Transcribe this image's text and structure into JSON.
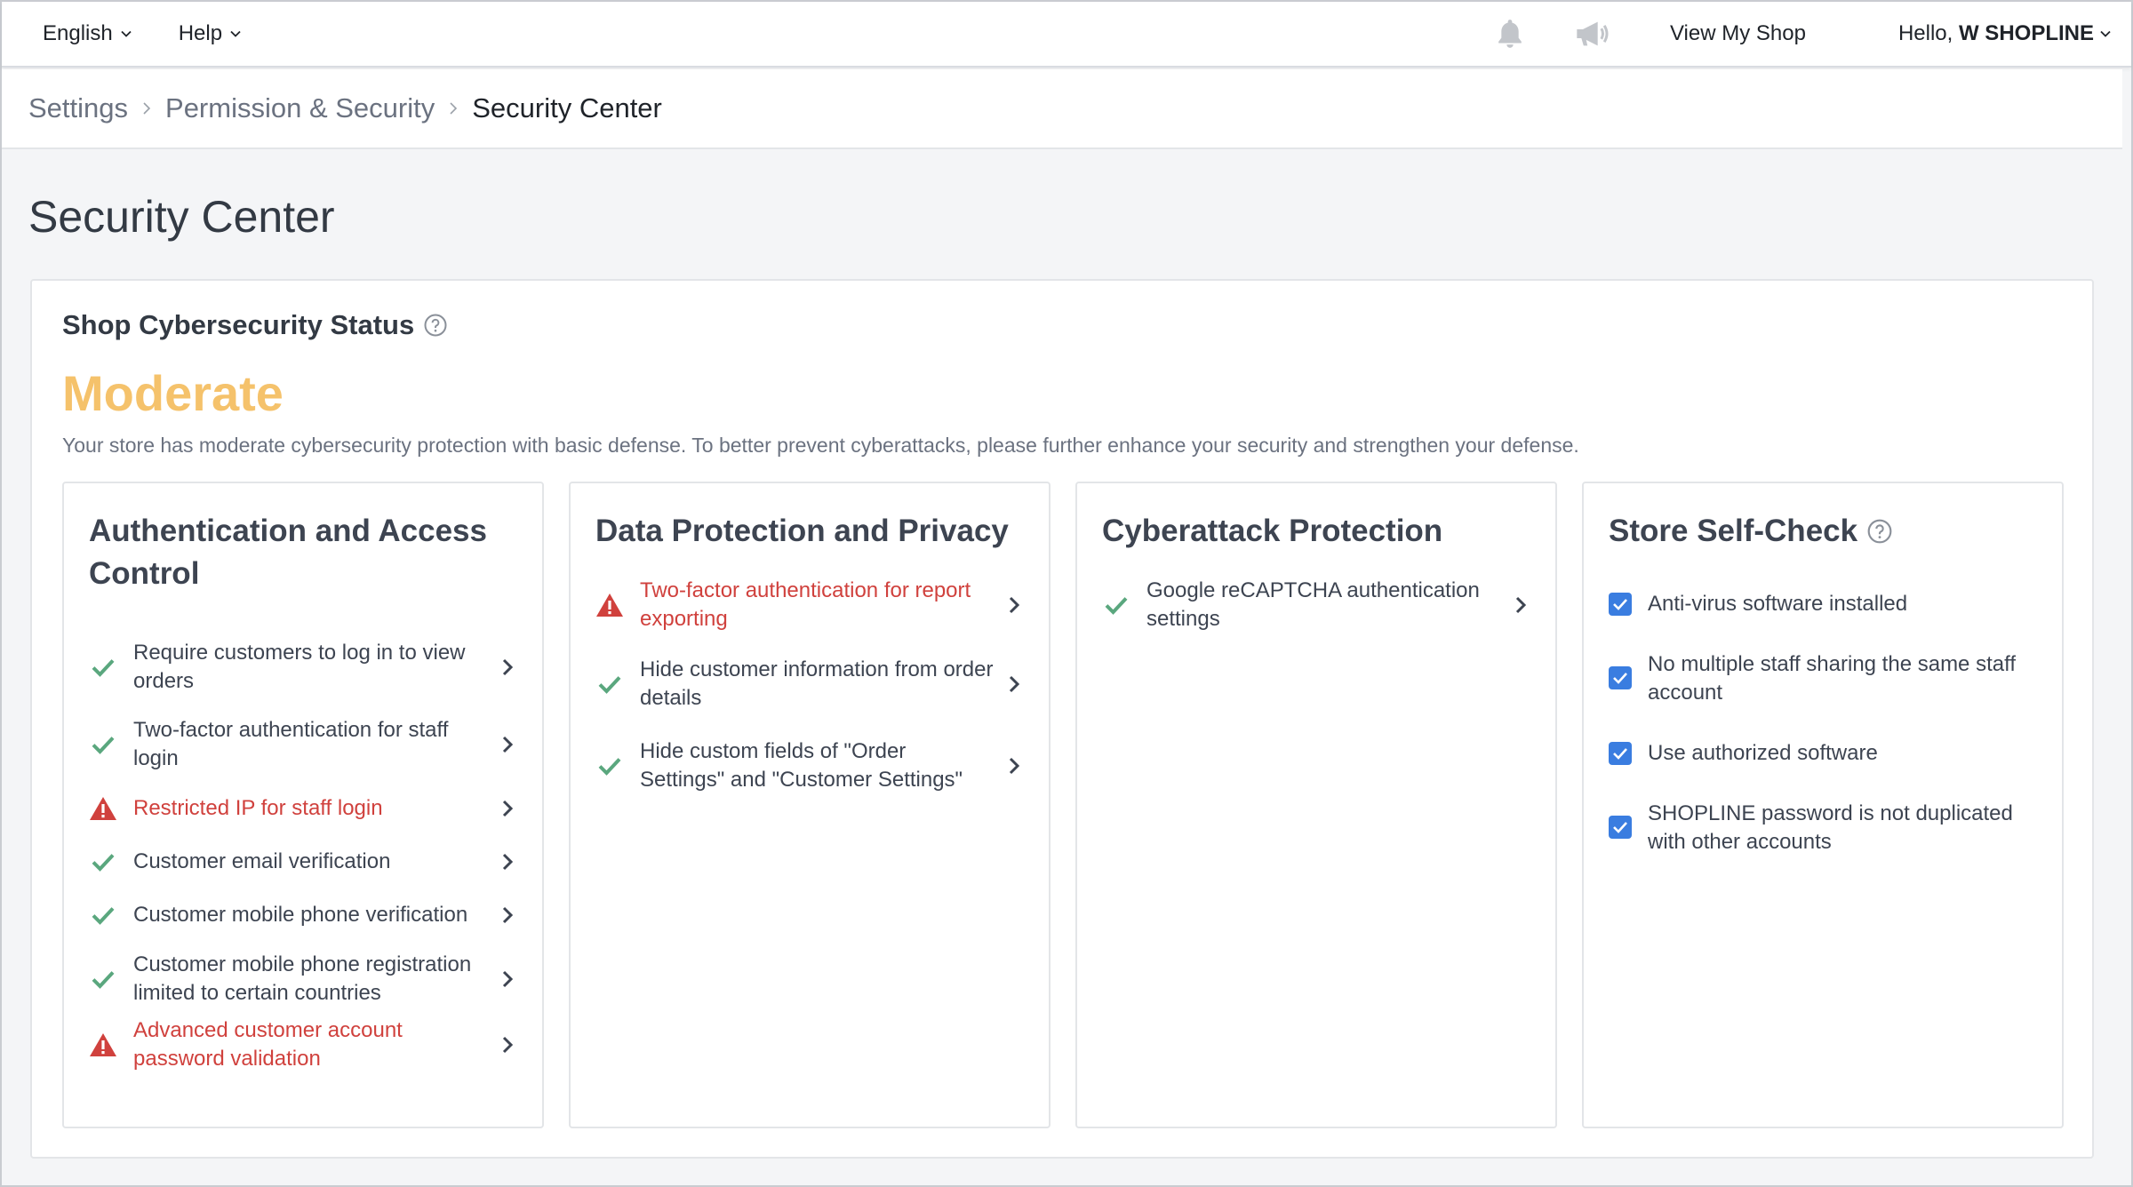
{
  "topbar": {
    "language": "English",
    "help": "Help",
    "view_shop": "View My Shop",
    "hello_prefix": "Hello, ",
    "user_name": "W SHOPLINE",
    "icons": [
      "bell-icon",
      "megaphone-icon"
    ]
  },
  "breadcrumb": {
    "items": [
      "Settings",
      "Permission & Security",
      "Security Center"
    ]
  },
  "page": {
    "title": "Security Center"
  },
  "status": {
    "heading": "Shop Cybersecurity Status",
    "level": "Moderate",
    "level_color": "#f5c26b",
    "description": "Your store has moderate cybersecurity protection with basic defense. To better prevent cyberattacks, please further enhance your security and strengthen your defense."
  },
  "colors": {
    "ok": "#5aa77e",
    "warn": "#d0413d",
    "checkbox": "#3a7de0"
  },
  "panels": [
    {
      "title": "Authentication and Access Control",
      "items": [
        {
          "label": "Require customers to log in to view orders",
          "status": "ok"
        },
        {
          "label": "Two-factor authentication for staff login",
          "status": "ok"
        },
        {
          "label": "Restricted IP for staff login",
          "status": "warn"
        },
        {
          "label": "Customer email verification",
          "status": "ok"
        },
        {
          "label": "Customer mobile phone verification",
          "status": "ok"
        },
        {
          "label": "Customer mobile phone registration limited to certain countries",
          "status": "ok"
        },
        {
          "label": "Advanced customer account password validation",
          "status": "warn"
        }
      ]
    },
    {
      "title": "Data Protection and Privacy",
      "items": [
        {
          "label": "Two-factor authentication for report exporting",
          "status": "warn"
        },
        {
          "label": "Hide customer information from order details",
          "status": "ok"
        },
        {
          "label": "Hide custom fields of \"Order Settings\" and \"Customer Settings\"",
          "status": "ok"
        }
      ]
    },
    {
      "title": "Cyberattack Protection",
      "items": [
        {
          "label": "Google reCAPTCHA authentication settings",
          "status": "ok"
        }
      ]
    },
    {
      "title": "Store Self-Check",
      "checks": [
        {
          "label": "Anti-virus software installed",
          "checked": true
        },
        {
          "label": "No multiple staff sharing the same staff account",
          "checked": true
        },
        {
          "label": "Use authorized software",
          "checked": true
        },
        {
          "label": "SHOPLINE password is not duplicated with other accounts",
          "checked": true
        }
      ]
    }
  ]
}
